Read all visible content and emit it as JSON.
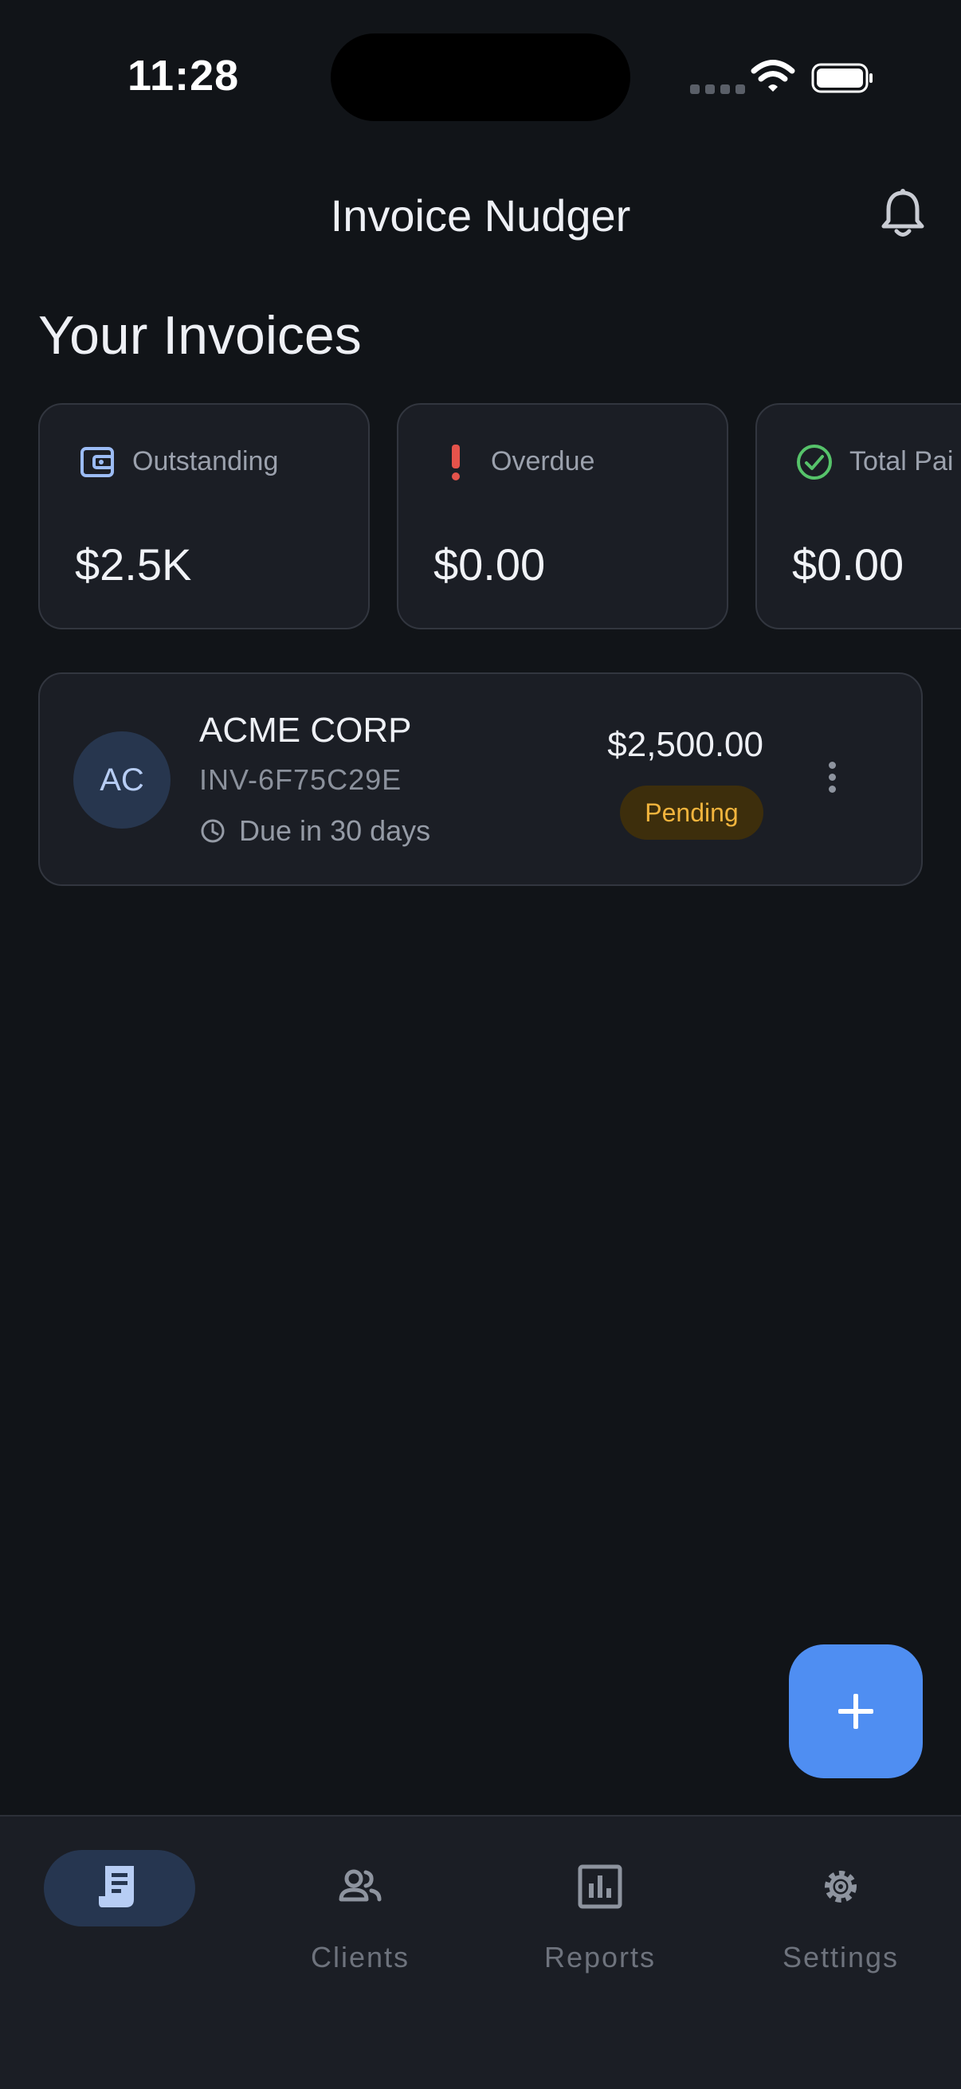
{
  "status_bar": {
    "time": "11:28"
  },
  "app_bar": {
    "title": "Invoice Nudger",
    "notifications_icon": "bell-icon"
  },
  "section_title": "Your Invoices",
  "summary_cards": [
    {
      "label": "Outstanding",
      "value": "$2.5K",
      "icon": "wallet-icon",
      "icon_color": "#9cbcf5"
    },
    {
      "label": "Overdue",
      "value": "$0.00",
      "icon": "exclamation-icon",
      "icon_color": "#e5534b"
    },
    {
      "label": "Total Pai",
      "value": "$0.00",
      "icon": "check-circle-icon",
      "icon_color": "#56c36a"
    }
  ],
  "invoices": [
    {
      "initials": "AC",
      "client": "ACME CORP",
      "invoice_id": "INV-6F75C29E",
      "due": "Due in 30 days",
      "amount": "$2,500.00",
      "status": "Pending",
      "status_color": "#f2b43d"
    }
  ],
  "fab": {
    "icon": "plus-icon",
    "color": "#4f8ef2"
  },
  "bottom_nav": {
    "items": [
      {
        "label": "",
        "icon": "invoice-receipt-icon",
        "active": true
      },
      {
        "label": "Clients",
        "icon": "people-icon",
        "active": false
      },
      {
        "label": "Reports",
        "icon": "bar-chart-icon",
        "active": false
      },
      {
        "label": "Settings",
        "icon": "gear-icon",
        "active": false
      }
    ]
  }
}
